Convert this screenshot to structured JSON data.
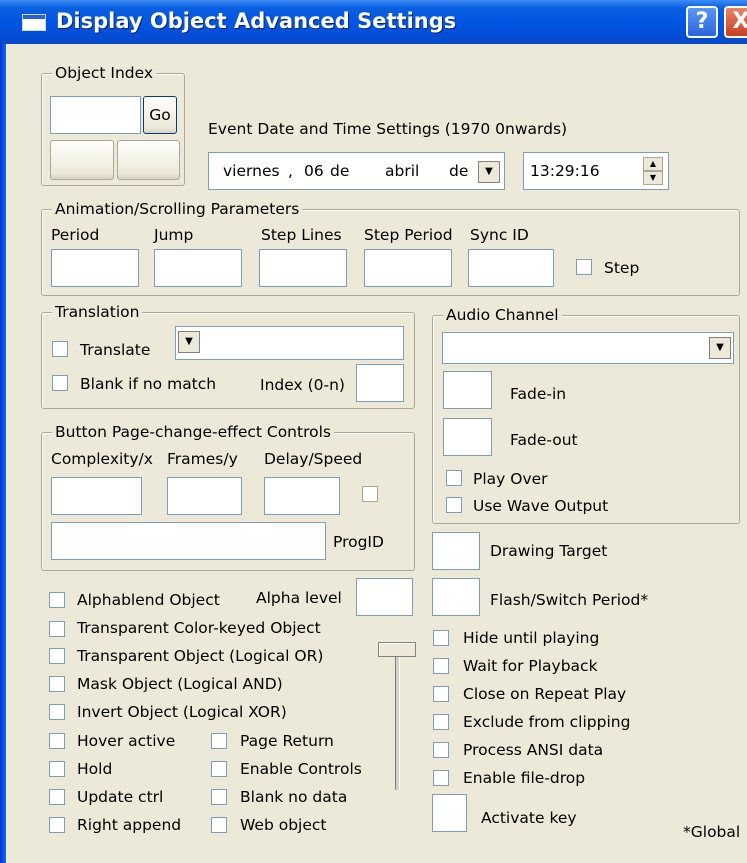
{
  "title": "Display Object Advanced Settings",
  "title_buttons": {
    "help": "?",
    "close": "X"
  },
  "object_index": {
    "group_label": "Object Index",
    "go_label": "Go",
    "index_value": ""
  },
  "event": {
    "label": "Event Date and Time Settings (1970 0nwards)",
    "date_weekday": "viernes",
    "date_sep1": ",",
    "date_day": "06",
    "date_de1": "de",
    "date_month": "abril",
    "date_de2": "de",
    "time": "13:29:16"
  },
  "animation": {
    "group_label": "Animation/Scrolling Parameters",
    "headers": [
      "Period",
      "Jump",
      "Step Lines",
      "Step Period",
      "Sync ID"
    ],
    "step_label": "Step"
  },
  "translation": {
    "group_label": "Translation",
    "translate_label": "Translate",
    "blank_label": "Blank if no match",
    "index_label": "Index (0-n)"
  },
  "audio": {
    "group_label": "Audio Channel",
    "fade_in": "Fade-in",
    "fade_out": "Fade-out",
    "play_over": "Play Over",
    "use_wave": "Use Wave Output"
  },
  "button_page": {
    "group_label": "Button Page-change-effect Controls",
    "headers": [
      "Complexity/x",
      "Frames/y",
      "Delay/Speed"
    ],
    "progid_label": "ProgID"
  },
  "drawing_target": "Drawing Target",
  "flash_period": "Flash/Switch Period*",
  "alpha_level": "Alpha level",
  "left_checks": [
    "Alphablend Object",
    "Transparent Color-keyed Object",
    "Transparent Object (Logical OR)",
    "Mask Object (Logical AND)",
    "Invert Object (Logical XOR)"
  ],
  "grid_checks_col1": [
    "Hover active",
    "Hold",
    "Update ctrl",
    "Right append"
  ],
  "grid_checks_col2": [
    "Page Return",
    "Enable Controls",
    "Blank no data",
    "Web object"
  ],
  "right_checks": [
    "Hide until playing",
    "Wait for Playback",
    "Close on Repeat Play",
    "Exclude from clipping",
    "Process ANSI data",
    "Enable file-drop"
  ],
  "activate_key": "Activate key",
  "global_note": "*Global"
}
